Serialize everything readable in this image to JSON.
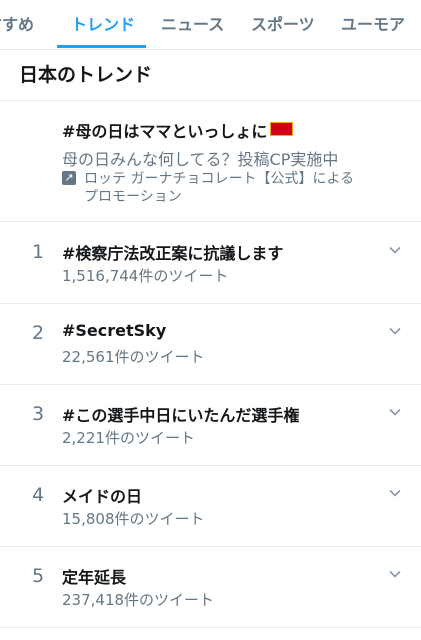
{
  "tabs": [
    {
      "label": "すすめ",
      "active": false
    },
    {
      "label": "トレンド",
      "active": true
    },
    {
      "label": "ニュース",
      "active": false
    },
    {
      "label": "スポーツ",
      "active": false
    },
    {
      "label": "ユーモア",
      "active": false
    }
  ],
  "section_title": "日本のトレンド",
  "promoted": {
    "title": "#母の日はママといっしょに",
    "description": "母の日みんな何してる？投稿CP実施中",
    "promoted_by_line1": "ロッテ ガーナチョコレート【公式】による",
    "promoted_by_line2": "プロモーション",
    "icon": "promoted-arrow-icon"
  },
  "trends": [
    {
      "rank": "1",
      "name": "#検察庁法改正案に抗議します",
      "count": "1,516,744件のツイート"
    },
    {
      "rank": "2",
      "name": "#SecretSky",
      "count": "22,561件のツイート"
    },
    {
      "rank": "3",
      "name": "#この選手中日にいたんだ選手権",
      "count": "2,221件のツイート"
    },
    {
      "rank": "4",
      "name": "メイドの日",
      "count": "15,808件のツイート"
    },
    {
      "rank": "5",
      "name": "定年延長",
      "count": "237,418件のツイート"
    }
  ],
  "colors": {
    "accent": "#1da1f2",
    "secondary_text": "#657786",
    "primary_text": "#14171a"
  }
}
